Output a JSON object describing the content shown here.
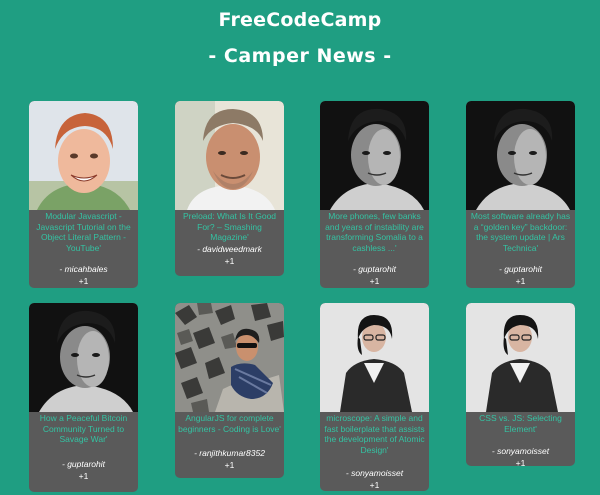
{
  "header": {
    "site_title": "FreeCodeCamp",
    "section_title": "- Camper News -"
  },
  "cards": [
    {
      "headline": "Modular Javascript - Javascript Tutorial on the Object Literal Pattern - YouTube'",
      "author": "- micahbales",
      "votes": "+1"
    },
    {
      "headline": "Preload: What Is It Good For? – Smashing Magazine'",
      "author": "- davidweedmark",
      "votes": "+1"
    },
    {
      "headline": "More phones, few banks and years of instability are transforming Somalia to a cashless ...'",
      "author": "- guptarohit",
      "votes": "+1"
    },
    {
      "headline": "Most software already has a “golden key” backdoor: the system update | Ars Technica'",
      "author": "- guptarohit",
      "votes": "+1"
    },
    {
      "headline": "How a Peaceful Bitcoin Community Turned to Savage War'",
      "author": "- guptarohit",
      "votes": "+1"
    },
    {
      "headline": "AngularJS for complete beginners - Coding is Love'",
      "author": "- ranjithkumar8352",
      "votes": "+1"
    },
    {
      "headline": "microscope: A simple and fast boilerplate that assists the development of Atomic Design'",
      "author": "- sonyamoisset",
      "votes": "+1"
    },
    {
      "headline": "CSS vs. JS: Selecting Element'",
      "author": "- sonyamoisset",
      "votes": "+1"
    }
  ],
  "colors": {
    "background": "#1f9e82",
    "card": "#5a5a5a",
    "headline": "#34c3a3",
    "text": "#ffffff"
  },
  "icons": {
    "avatar": "user-photo"
  }
}
